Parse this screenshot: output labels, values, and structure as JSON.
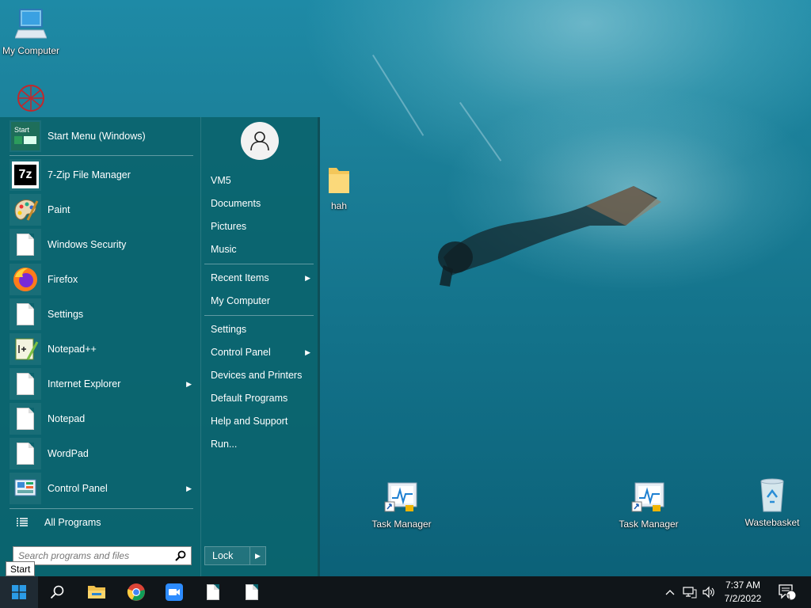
{
  "desktop": {
    "icons": [
      {
        "label": "My Computer"
      },
      {
        "label": ""
      },
      {
        "label": "hah"
      },
      {
        "label": "Task Manager"
      },
      {
        "label": "Task Manager"
      },
      {
        "label": "Wastebasket"
      }
    ]
  },
  "start_menu": {
    "programs": [
      {
        "label": "Start Menu (Windows)",
        "icon": "start-menu-icon",
        "has_submenu": false
      },
      {
        "label": "7-Zip File Manager",
        "icon": "7zip-icon",
        "icon_text": "7z",
        "has_submenu": false
      },
      {
        "label": "Paint",
        "icon": "paint-palette-icon",
        "has_submenu": false
      },
      {
        "label": "Windows Security",
        "icon": "document-icon",
        "has_submenu": false
      },
      {
        "label": "Firefox",
        "icon": "firefox-icon",
        "has_submenu": false
      },
      {
        "label": "Settings",
        "icon": "document-icon",
        "has_submenu": false
      },
      {
        "label": "Notepad++",
        "icon": "notepad-plus-plus-icon",
        "has_submenu": false
      },
      {
        "label": "Internet Explorer",
        "icon": "document-icon",
        "has_submenu": true
      },
      {
        "label": "Notepad",
        "icon": "document-icon",
        "has_submenu": false
      },
      {
        "label": "WordPad",
        "icon": "document-icon",
        "has_submenu": false
      },
      {
        "label": "Control Panel",
        "icon": "control-panel-icon",
        "has_submenu": true
      }
    ],
    "start_icon_text": "Start",
    "all_programs": "All Programs",
    "search_placeholder": "Search programs and files",
    "right_items": [
      {
        "label": "VM5",
        "has_submenu": false
      },
      {
        "label": "Documents",
        "has_submenu": false
      },
      {
        "label": "Pictures",
        "has_submenu": false
      },
      {
        "label": "Music",
        "has_submenu": false
      },
      {
        "label": "Recent Items",
        "has_submenu": true
      },
      {
        "label": "My Computer",
        "has_submenu": false
      },
      {
        "label": "Settings",
        "has_submenu": false
      },
      {
        "label": "Control Panel",
        "has_submenu": true
      },
      {
        "label": "Devices and Printers",
        "has_submenu": false
      },
      {
        "label": "Default Programs",
        "has_submenu": false
      },
      {
        "label": "Help and Support",
        "has_submenu": false
      },
      {
        "label": "Run...",
        "has_submenu": false
      }
    ],
    "lock_label": "Lock"
  },
  "tooltip": "Start",
  "taskbar": {
    "pinned": [
      "windows-start-icon",
      "search-icon",
      "file-explorer-icon",
      "chrome-icon",
      "zoom-meeting-icon",
      "document-icon",
      "document-icon"
    ],
    "time": "7:37 AM",
    "date": "7/2/2022",
    "notification_count": "1"
  },
  "colors": {
    "menu_bg": "#0b646e",
    "taskbar_bg": "#101519",
    "accent": "#0078d7"
  }
}
